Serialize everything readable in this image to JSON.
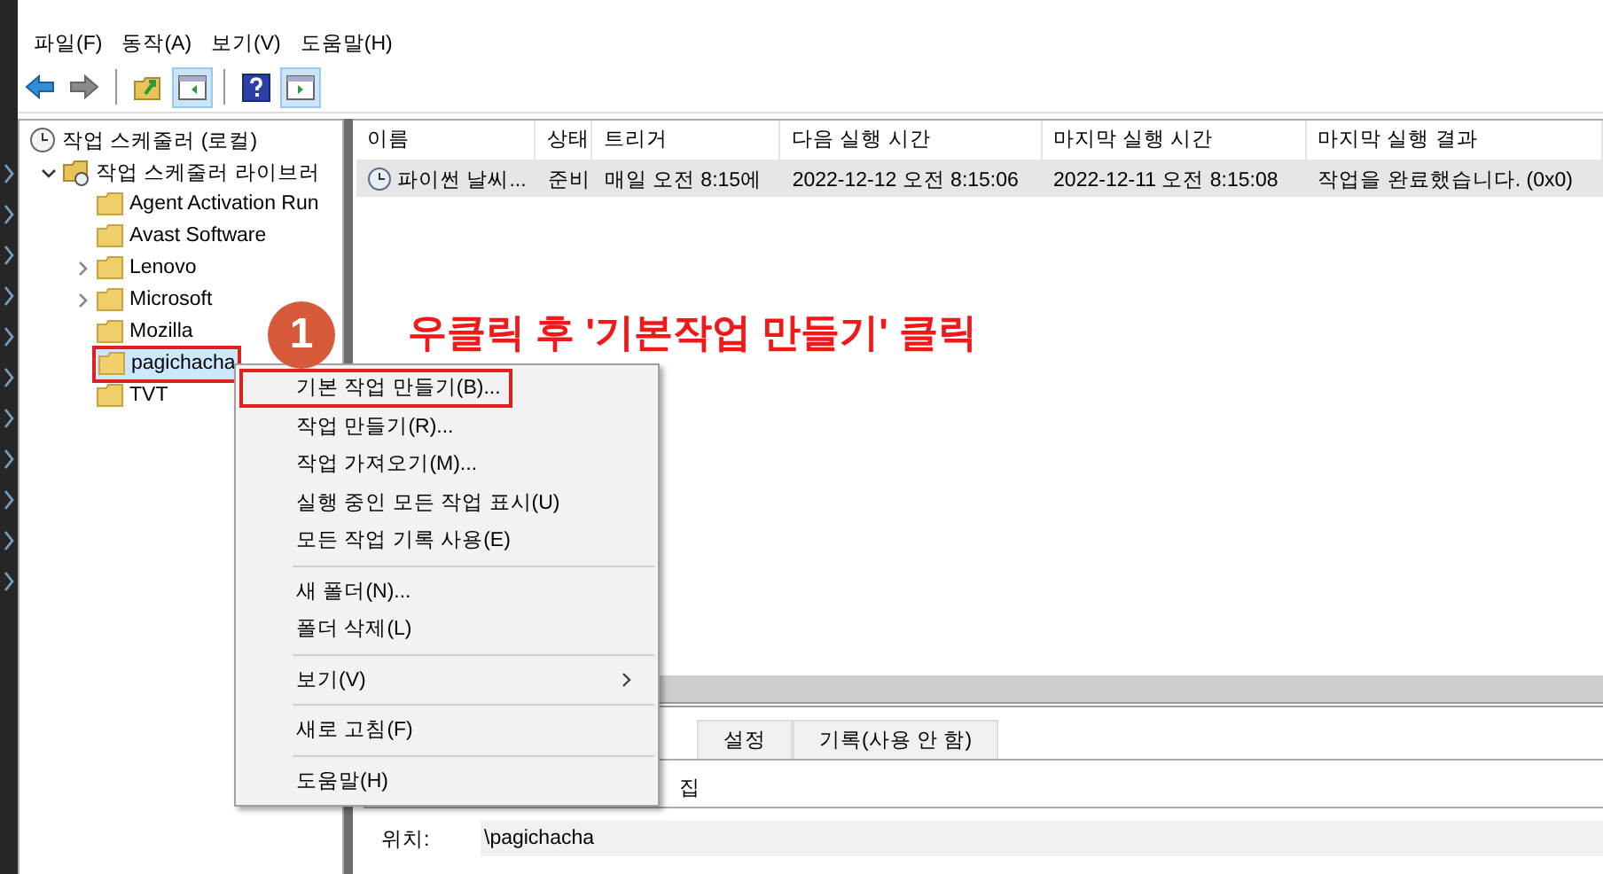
{
  "menu_bar": [
    {
      "label": "파일(F)"
    },
    {
      "label": "동작(A)"
    },
    {
      "label": "보기(V)"
    },
    {
      "label": "도움말(H)"
    }
  ],
  "toolbar": [
    {
      "kind": "back",
      "pressed": false
    },
    {
      "kind": "forward",
      "pressed": false
    },
    {
      "kind": "separator"
    },
    {
      "kind": "up",
      "pressed": false
    },
    {
      "kind": "pane-left",
      "pressed": true
    },
    {
      "kind": "separator"
    },
    {
      "kind": "help",
      "pressed": false
    },
    {
      "kind": "pane-right",
      "pressed": true
    }
  ],
  "tree": [
    {
      "label": "작업 스케줄러 (로컬)",
      "kind": "clock",
      "selected": false,
      "boxed": false,
      "children": [
        {
          "label": "작업 스케줄러 라이브러",
          "kind": "library",
          "expanded": true,
          "selected": false,
          "boxed": false,
          "children": [
            {
              "label": "Agent Activation Run",
              "kind": "folder",
              "selected": false,
              "boxed": false
            },
            {
              "label": "Avast Software",
              "kind": "folder",
              "selected": false,
              "boxed": false
            },
            {
              "label": "Lenovo",
              "kind": "folder",
              "expanded": false,
              "selected": false,
              "boxed": false
            },
            {
              "label": "Microsoft",
              "kind": "folder",
              "expanded": false,
              "selected": false,
              "boxed": false
            },
            {
              "label": "Mozilla",
              "kind": "folder",
              "selected": false,
              "boxed": false
            },
            {
              "label": "pagichacha",
              "kind": "folder",
              "selected": true,
              "boxed": true
            },
            {
              "label": "TVT",
              "kind": "folder",
              "selected": false,
              "boxed": false
            }
          ]
        }
      ]
    }
  ],
  "table": {
    "columns": [
      "이름",
      "상태",
      "트리거",
      "다음 실행 시간",
      "마지막 실행 시간",
      "마지막 실행 결과"
    ],
    "rows": [
      {
        "selected": true,
        "cells": [
          "파이썬 날씨...",
          "준비",
          "매일 오전 8:15에",
          "2022-12-12 오전 8:15:06",
          "2022-12-11 오전 8:15:08",
          "작업을 완료했습니다. (0x0)"
        ]
      }
    ]
  },
  "details": {
    "tabs": [
      {
        "label": "설정",
        "selected": false
      },
      {
        "label": "기록(사용 안 함)",
        "selected": false
      }
    ],
    "partial_text": "집",
    "location_label": "위치:",
    "location_value": "\\pagichacha"
  },
  "context_menu": [
    {
      "kind": "item",
      "label": "기본 작업 만들기(B)...",
      "boxed": true,
      "submenu": false
    },
    {
      "kind": "item",
      "label": "작업 만들기(R)...",
      "boxed": false,
      "submenu": false
    },
    {
      "kind": "item",
      "label": "작업 가져오기(M)...",
      "boxed": false,
      "submenu": false
    },
    {
      "kind": "item",
      "label": "실행 중인 모든 작업 표시(U)",
      "boxed": false,
      "submenu": false
    },
    {
      "kind": "item",
      "label": "모든 작업 기록 사용(E)",
      "boxed": false,
      "submenu": false
    },
    {
      "kind": "separator"
    },
    {
      "kind": "item",
      "label": "새 폴더(N)...",
      "boxed": false,
      "submenu": false
    },
    {
      "kind": "item",
      "label": "폴더 삭제(L)",
      "boxed": false,
      "submenu": false
    },
    {
      "kind": "separator"
    },
    {
      "kind": "item",
      "label": "보기(V)",
      "boxed": false,
      "submenu": true
    },
    {
      "kind": "separator"
    },
    {
      "kind": "item",
      "label": "새로 고침(F)",
      "boxed": false,
      "submenu": false
    },
    {
      "kind": "separator"
    },
    {
      "kind": "item",
      "label": "도움말(H)",
      "boxed": false,
      "submenu": false
    }
  ],
  "annotation": {
    "badge": "1",
    "note": "우클릭 후 '기본작업 만들기' 클릭"
  }
}
